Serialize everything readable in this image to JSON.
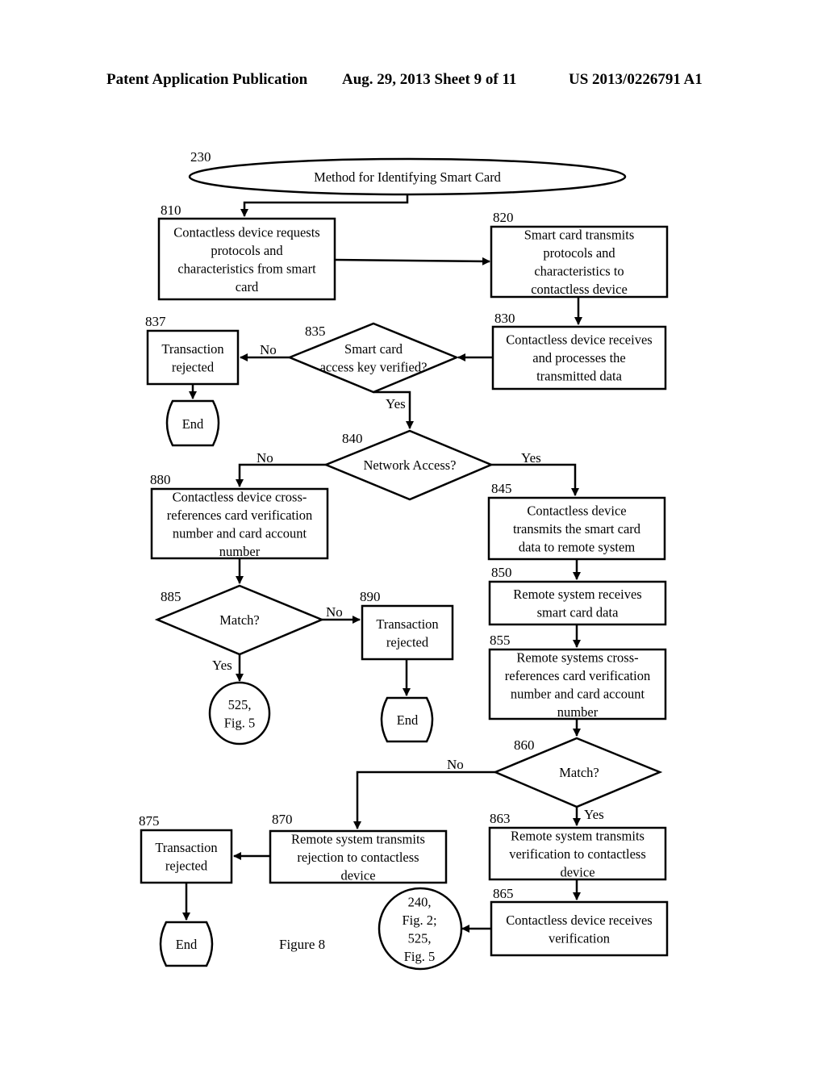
{
  "header": {
    "publication": "Patent Application Publication",
    "date_sheet": "Aug. 29, 2013  Sheet 9 of 11",
    "number": "US 2013/0226791 A1"
  },
  "figure_caption": "Figure 8",
  "nodes": {
    "n230": {
      "ref": "230",
      "lines": [
        "Method for Identifying Smart Card"
      ]
    },
    "n810": {
      "ref": "810",
      "lines": [
        "Contactless device requests",
        "protocols and",
        "characteristics from smart",
        "card"
      ]
    },
    "n820": {
      "ref": "820",
      "lines": [
        "Smart card transmits",
        "protocols and",
        "characteristics to",
        "contactless device"
      ]
    },
    "n830": {
      "ref": "830",
      "lines": [
        "Contactless device receives",
        "and processes the",
        "transmitted data"
      ]
    },
    "n835": {
      "ref": "835",
      "lines": [
        "Smart card",
        "access key verified?"
      ]
    },
    "n837": {
      "ref": "837",
      "lines": [
        "Transaction",
        "rejected"
      ]
    },
    "end837": {
      "lines": [
        "End"
      ]
    },
    "n840": {
      "ref": "840",
      "lines": [
        "Network Access?"
      ]
    },
    "n880": {
      "ref": "880",
      "lines": [
        "Contactless device cross-",
        "references card verification",
        "number and card account",
        "number"
      ]
    },
    "n845": {
      "ref": "845",
      "lines": [
        "Contactless device",
        "transmits the smart card",
        "data to remote system"
      ]
    },
    "n885": {
      "ref": "885",
      "lines": [
        "Match?"
      ]
    },
    "n890": {
      "ref": "890",
      "lines": [
        "Transaction",
        "rejected"
      ]
    },
    "end890": {
      "lines": [
        "End"
      ]
    },
    "conn525": {
      "lines": [
        "525,",
        "Fig. 5"
      ]
    },
    "n850": {
      "ref": "850",
      "lines": [
        "Remote system receives",
        "smart card data"
      ]
    },
    "n855": {
      "ref": "855",
      "lines": [
        "Remote systems cross-",
        "references card verification",
        "number and card account",
        "number"
      ]
    },
    "n860": {
      "ref": "860",
      "lines": [
        "Match?"
      ]
    },
    "n863": {
      "ref": "863",
      "lines": [
        "Remote system transmits",
        "verification to contactless",
        "device"
      ]
    },
    "n870": {
      "ref": "870",
      "lines": [
        "Remote system transmits",
        "rejection to contactless",
        "device"
      ]
    },
    "n875": {
      "ref": "875",
      "lines": [
        "Transaction",
        "rejected"
      ]
    },
    "end875": {
      "lines": [
        "End"
      ]
    },
    "n865": {
      "ref": "865",
      "lines": [
        "Contactless device receives",
        "verification"
      ]
    },
    "conn240": {
      "lines": [
        "240,",
        "Fig. 2;",
        "525,",
        "Fig. 5"
      ]
    }
  },
  "edge_labels": {
    "e835_no": "No",
    "e835_yes": "Yes",
    "e840_no": "No",
    "e840_yes": "Yes",
    "e885_no": "No",
    "e885_yes": "Yes",
    "e860_no": "No",
    "e860_yes": "Yes"
  }
}
